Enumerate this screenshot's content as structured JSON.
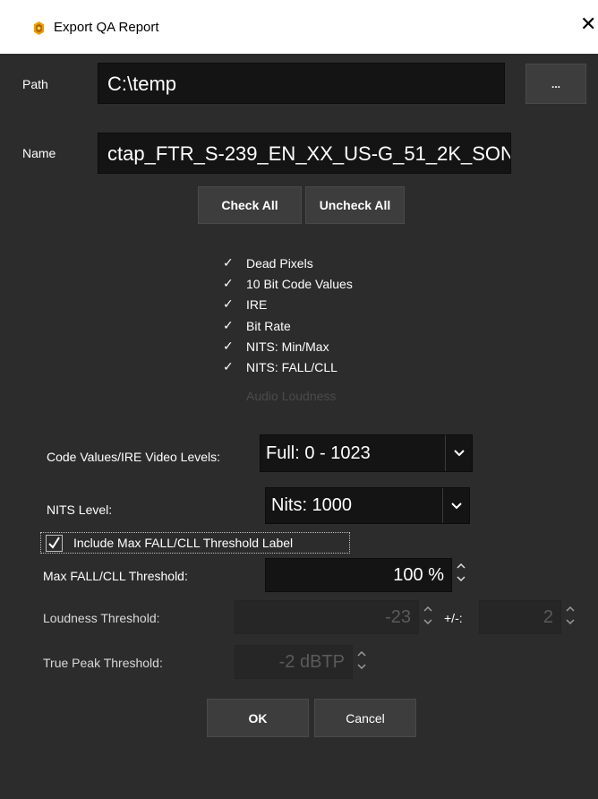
{
  "window": {
    "title": "Export QA Report",
    "close_glyph": "✕"
  },
  "path": {
    "label": "Path",
    "value": "C:\\temp",
    "browse_label": "..."
  },
  "name": {
    "label": "Name",
    "value": "ctap_FTR_S-239_EN_XX_US-G_51_2K_SON"
  },
  "actions": {
    "check_all": "Check All",
    "uncheck_all": "Uncheck All"
  },
  "checks": [
    {
      "label": "Dead Pixels",
      "checked": true
    },
    {
      "label": "10 Bit Code Values",
      "checked": true
    },
    {
      "label": "IRE",
      "checked": true
    },
    {
      "label": "Bit Rate",
      "checked": true
    },
    {
      "label": "NITS: Min/Max",
      "checked": true
    },
    {
      "label": "NITS: FALL/CLL",
      "checked": true
    },
    {
      "label": "Audio Loudness",
      "checked": false,
      "disabled": true
    }
  ],
  "check_glyph": "✓",
  "levels": {
    "label": "Code Values/IRE Video Levels:",
    "value": "Full: 0 - 1023"
  },
  "nits": {
    "label": "NITS Level:",
    "value": "Nits: 1000"
  },
  "include_label": {
    "label": "Include Max FALL/CLL Threshold Label",
    "checked": true
  },
  "max_fall": {
    "label": "Max FALL/CLL Threshold:",
    "value": "100 %"
  },
  "loudness": {
    "label": "Loudness Threshold:",
    "value": "-23",
    "tolerance_label": "+/-:",
    "tolerance_value": "2"
  },
  "true_peak": {
    "label": "True Peak Threshold:",
    "value": "-2 dBTP"
  },
  "footer": {
    "ok": "OK",
    "cancel": "Cancel"
  },
  "colors": {
    "background": "#2c2c2c",
    "field": "#141414",
    "button": "#3d3d3d",
    "titlebar": "#ffffff",
    "disabled_text": "#4b4b4b"
  },
  "icons": {
    "app": "gold-gear-icon",
    "close": "close-icon",
    "dropdown": "chevron-down-icon",
    "stepper": "up-down-arrows-icon"
  }
}
